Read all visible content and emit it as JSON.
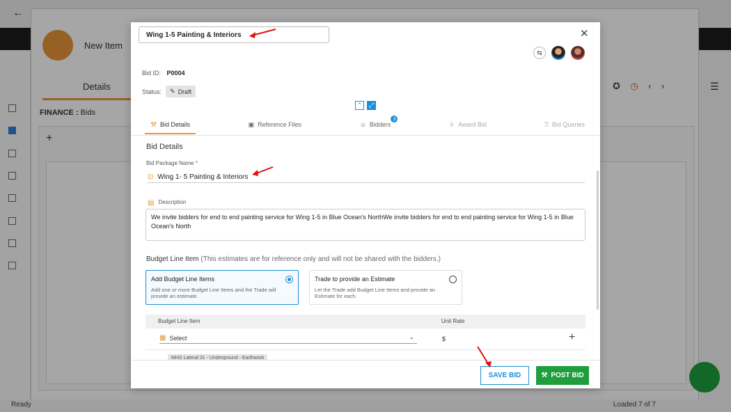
{
  "background": {
    "window_title": "New Item",
    "details_tab": "Details",
    "breadcrumb_module": "FINANCE :",
    "breadcrumb_page": "Bids",
    "status_ready": "Ready",
    "loaded_text": "Loaded 7 of 7"
  },
  "modal": {
    "title_value": "Wing 1-5 Painting & Interiors",
    "bid_id_label": "Bid ID:",
    "bid_id_value": "P0004",
    "status_label": "Status:",
    "status_value": "Draft",
    "tabs": [
      {
        "label": "Bid Details",
        "active": true
      },
      {
        "label": "Reference Files"
      },
      {
        "label": "Bidders",
        "count": "3"
      },
      {
        "label": "Award Bid",
        "disabled": true
      },
      {
        "label": "Bid Queries",
        "disabled": true
      }
    ],
    "section_title": "Bid Details",
    "bid_package_label": "Bid Package Name",
    "bid_package_required": "*",
    "bid_package_value": "Wing 1- 5 Painting & Interiors",
    "description_label": "Description",
    "description_value": "We invite bidders for end to end painting service for Wing 1-5 in Blue Ocean's NorthWe invite bidders for end to end painting service for Wing 1-5 in Blue Ocean's North",
    "budget_line_title": "Budget Line Item",
    "budget_line_note": "(This estimates are for reference only and will not be shared with the bidders.)",
    "option_add": {
      "title": "Add Budget Line Items",
      "desc": "Add one or more Budget Line Items and the Trade will provide an estimate.",
      "selected": true
    },
    "option_trade": {
      "title": "Trade to provide an Estimate",
      "desc": "Let the Trade add Budget Line Items and provide an Estimate for each.",
      "selected": false
    },
    "table_headers": {
      "item": "Budget Line Item",
      "rate": "Unit Rate"
    },
    "select_placeholder": "Select",
    "currency_symbol": "$",
    "chip_text": "MHS Lateral 31 - Underground - Earthwork",
    "save_label": "SAVE BID",
    "post_label": "POST BID"
  },
  "colors": {
    "accent_orange": "#e8953b",
    "primary_blue": "#1b8fd6",
    "post_green": "#1e9e3c",
    "annotation_red": "#e01010"
  }
}
